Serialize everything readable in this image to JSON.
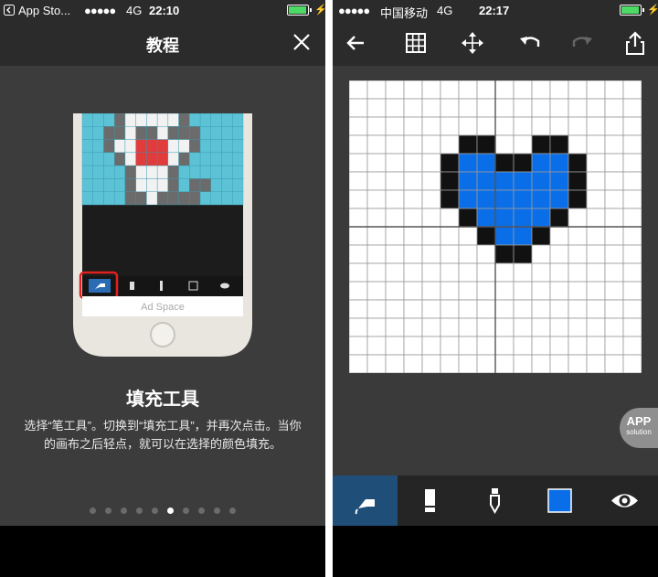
{
  "left_screen": {
    "status": {
      "back_app": "App Sto...",
      "signal": "●●●●●",
      "network": "4G",
      "time": "22:10"
    },
    "nav": {
      "title": "教程",
      "close_icon": "close-icon"
    },
    "illustration": {
      "ad_label": "Ad Space",
      "highlighted_tool": "fill-tool-icon"
    },
    "headline": "填充工具",
    "description": "选择“笔工具”。切换到“填充工具”，并再次点击。当你的画布之后轻点，就可以在选择的颜色填充。",
    "pager": {
      "count": 10,
      "active": 5
    }
  },
  "right_screen": {
    "status": {
      "signal": "●●●●●",
      "carrier": "中国移动",
      "network": "4G",
      "time": "22:17"
    },
    "toolbar": [
      "back-arrow-icon",
      "grid-icon",
      "move-icon",
      "undo-icon",
      "redo-icon",
      "share-icon"
    ],
    "canvas": {
      "size": 16,
      "colors": {
        "empty": "#ffffff",
        "outline": "#111111",
        "fill": "#0a6ee8",
        "grid": "#9a9a9a"
      },
      "rows": [
        "................",
        "................",
        "................",
        "......OO..OO....",
        ".....OFFOOFFO...",
        ".....OFFFFFFO...",
        ".....OFFFFFFO...",
        "......OFFFFO....",
        ".......OFFO.....",
        "........OO......",
        "................",
        "................",
        "................",
        "................",
        "................",
        "................"
      ]
    },
    "badge": {
      "line1": "APP",
      "line2": "solution"
    },
    "bottom_tools": [
      "fill-tool-icon",
      "eraser-icon",
      "eyedropper-icon",
      "color-swatch-icon",
      "eye-icon"
    ],
    "active_tool": "fill-tool-icon",
    "current_color": "#0a6ee8"
  }
}
